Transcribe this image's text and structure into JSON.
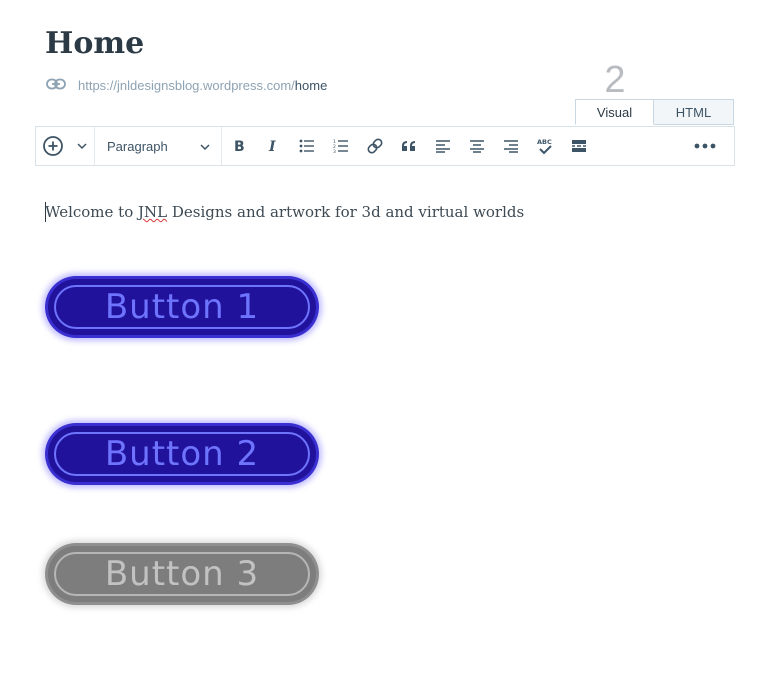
{
  "post": {
    "title": "Home",
    "permalink_base": "https://jnldesignsblog.wordpress.com/",
    "permalink_slug": "home"
  },
  "word_count": "2",
  "mode_tabs": [
    {
      "label": "Visual",
      "active": true
    },
    {
      "label": "HTML",
      "active": false
    }
  ],
  "toolbar": {
    "format_select": "Paragraph",
    "icons": [
      "add-block-icon",
      "chevron-down-icon",
      "bold-icon",
      "italic-icon",
      "bulleted-list-icon",
      "numbered-list-icon",
      "link-icon",
      "blockquote-icon",
      "align-left-icon",
      "align-center-icon",
      "align-right-icon",
      "spellcheck-icon",
      "read-more-icon",
      "more-icon"
    ]
  },
  "content": {
    "paragraph": {
      "before": "Welcome to ",
      "misspelled": "JNL",
      "after": " Designs and artwork for 3d and virtual worlds"
    },
    "images": [
      {
        "label": "Button 1",
        "style": "blue"
      },
      {
        "label": "Button 2",
        "style": "blue"
      },
      {
        "label": "Button 3",
        "style": "gray"
      }
    ]
  },
  "colors": {
    "button_blue_fill": "#20129a",
    "button_blue_text": "#6f74ff",
    "button_gray_fill": "#7d7d7d",
    "button_gray_text": "#c2c2c2"
  }
}
